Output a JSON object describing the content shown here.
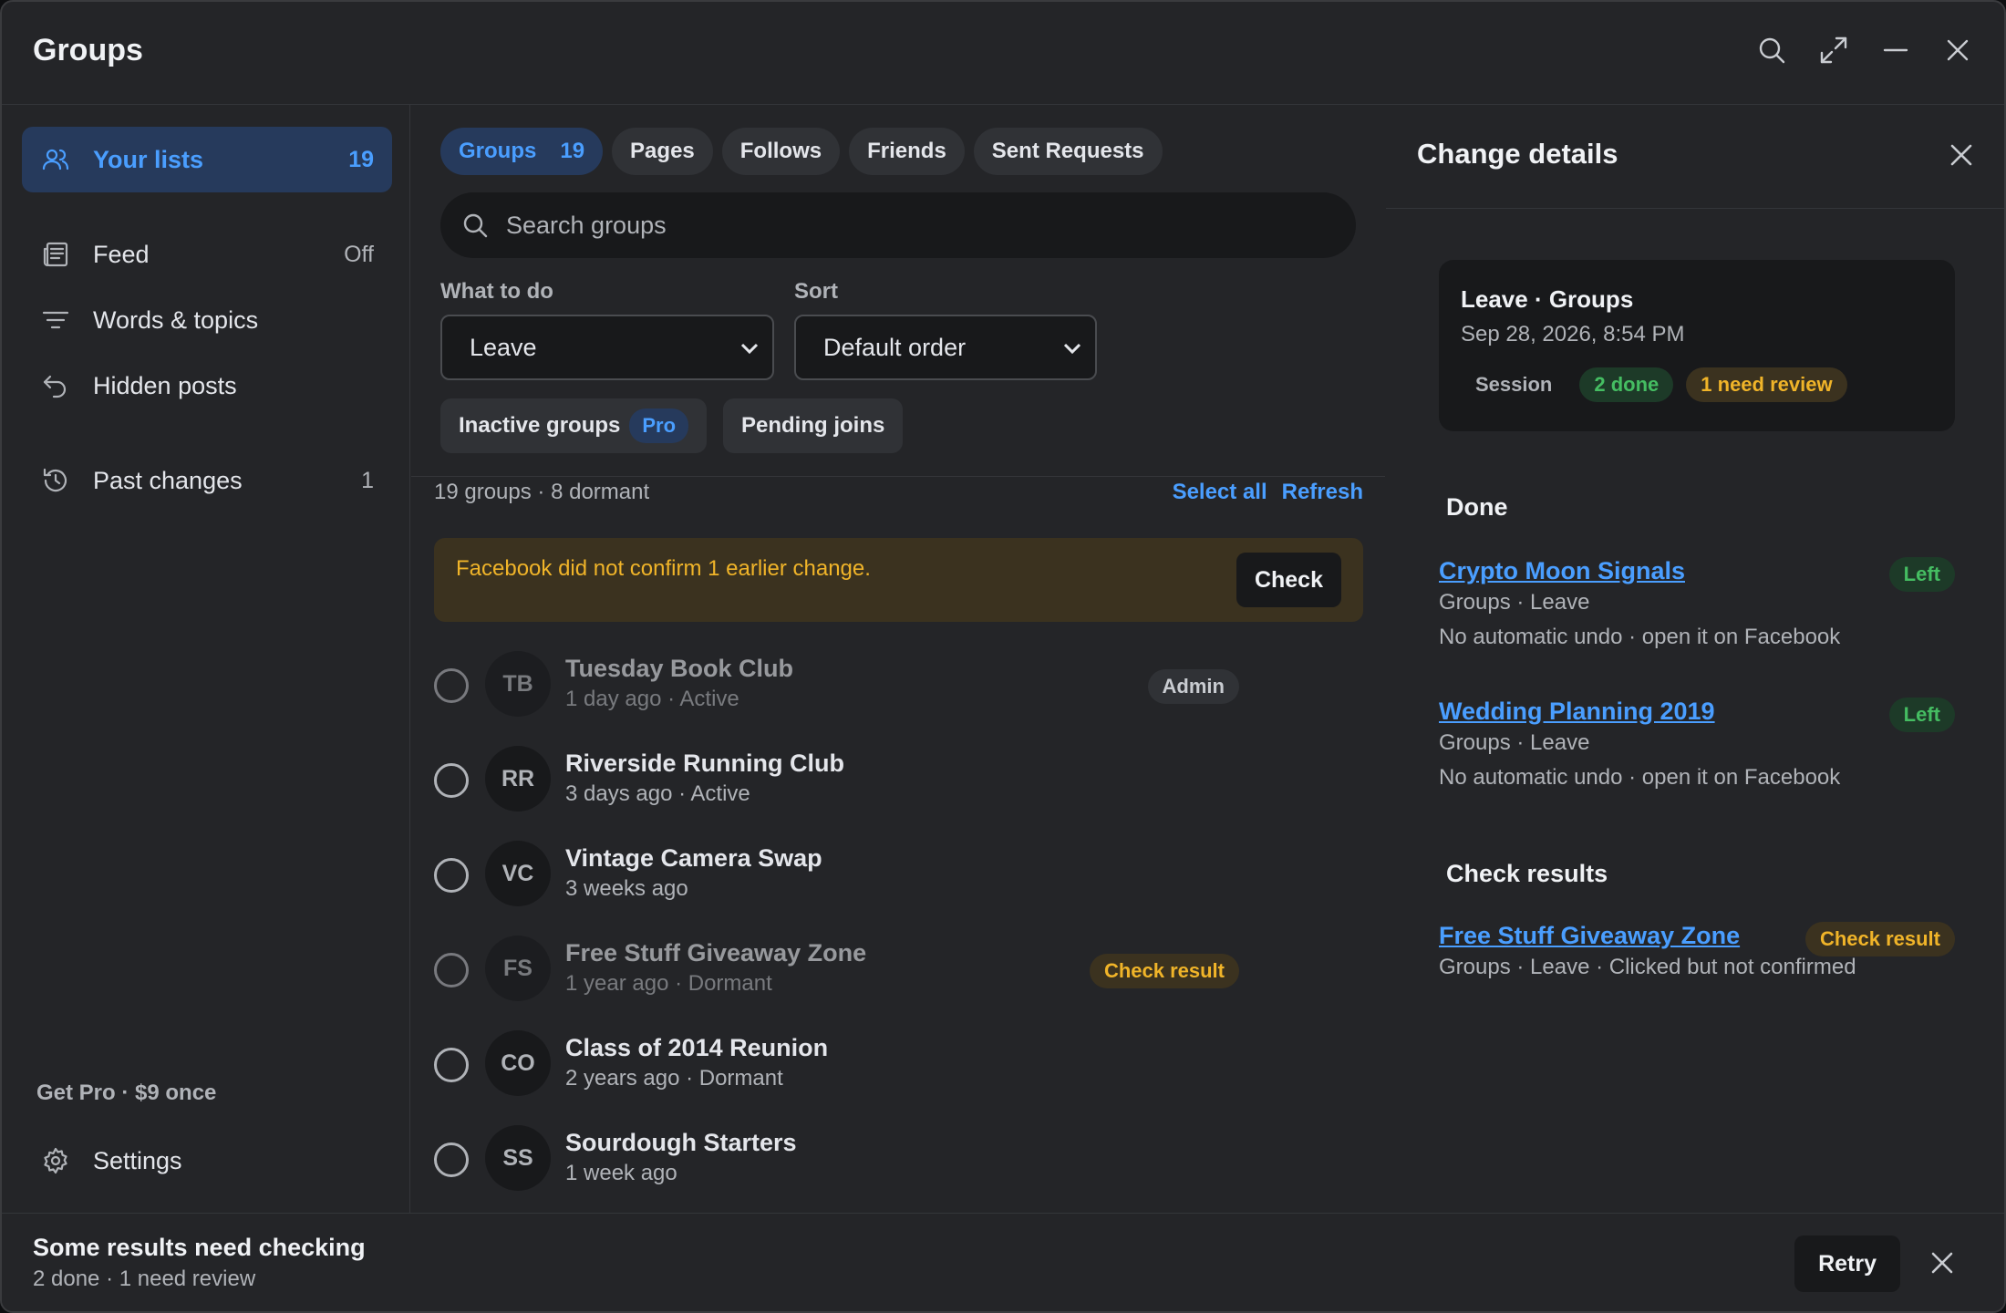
{
  "window": {
    "title": "Groups"
  },
  "sidebar": {
    "items": [
      {
        "label": "Your lists",
        "count": "19",
        "icon": "users-icon"
      },
      {
        "label": "Feed",
        "count": "Off",
        "icon": "newspaper-icon"
      },
      {
        "label": "Words & topics",
        "count": "",
        "icon": "filter-icon"
      },
      {
        "label": "Hidden posts",
        "count": "",
        "icon": "undo-icon"
      },
      {
        "label": "Past changes",
        "count": "1",
        "icon": "history-icon"
      }
    ],
    "get_pro": "Get Pro · $9 once",
    "settings": "Settings"
  },
  "main": {
    "tabs": [
      {
        "label": "Groups",
        "count": "19"
      },
      {
        "label": "Pages",
        "count": ""
      },
      {
        "label": "Follows",
        "count": ""
      },
      {
        "label": "Friends",
        "count": ""
      },
      {
        "label": "Sent Requests",
        "count": ""
      }
    ],
    "search_placeholder": "Search groups",
    "what_label": "What to do",
    "what_value": "Leave",
    "sort_label": "Sort",
    "sort_value": "Default order",
    "chips": {
      "inactive": "Inactive groups",
      "pro": "Pro",
      "pending": "Pending joins"
    },
    "summary": "19 groups · 8 dormant",
    "select_all": "Select all",
    "refresh": "Refresh",
    "warning": {
      "text": "Facebook did not confirm 1 earlier change.",
      "button": "Check"
    },
    "rows": [
      {
        "initials": "TB",
        "name": "Tuesday Book Club",
        "meta": "1 day ago · Active",
        "badge": "Admin"
      },
      {
        "initials": "RR",
        "name": "Riverside Running Club",
        "meta": "3 days ago · Active",
        "badge": ""
      },
      {
        "initials": "VC",
        "name": "Vintage Camera Swap",
        "meta": "3 weeks ago",
        "badge": ""
      },
      {
        "initials": "FS",
        "name": "Free Stuff Giveaway Zone",
        "meta": "1 year ago · Dormant",
        "badge": "Check result"
      },
      {
        "initials": "CO",
        "name": "Class of 2014 Reunion",
        "meta": "2 years ago · Dormant",
        "badge": ""
      },
      {
        "initials": "SS",
        "name": "Sourdough Starters",
        "meta": "1 week ago",
        "badge": ""
      }
    ]
  },
  "detail": {
    "title": "Change details",
    "session": {
      "title": "Leave · Groups",
      "date": "Sep 28, 2026, 8:54 PM",
      "label": "Session",
      "done": "2 done",
      "review": "1 need review"
    },
    "done_heading": "Done",
    "done": [
      {
        "name": "Crypto Moon Signals",
        "line1": "Groups · Leave",
        "line2": "No automatic undo · open it on Facebook",
        "tag": "Left"
      },
      {
        "name": "Wedding Planning 2019",
        "line1": "Groups · Leave",
        "line2": "No automatic undo · open it on Facebook",
        "tag": "Left"
      }
    ],
    "check_heading": "Check results",
    "check": [
      {
        "name": "Free Stuff Giveaway Zone",
        "line1": "Groups · Leave · Clicked but not confirmed",
        "tag": "Check result"
      }
    ]
  },
  "status": {
    "title": "Some results need checking",
    "sub": "2 done · 1 need review",
    "retry": "Retry"
  },
  "colors": {
    "accent": "#4a9eff",
    "success": "#45bd62",
    "warning": "#f0b429",
    "background": "#242528"
  }
}
